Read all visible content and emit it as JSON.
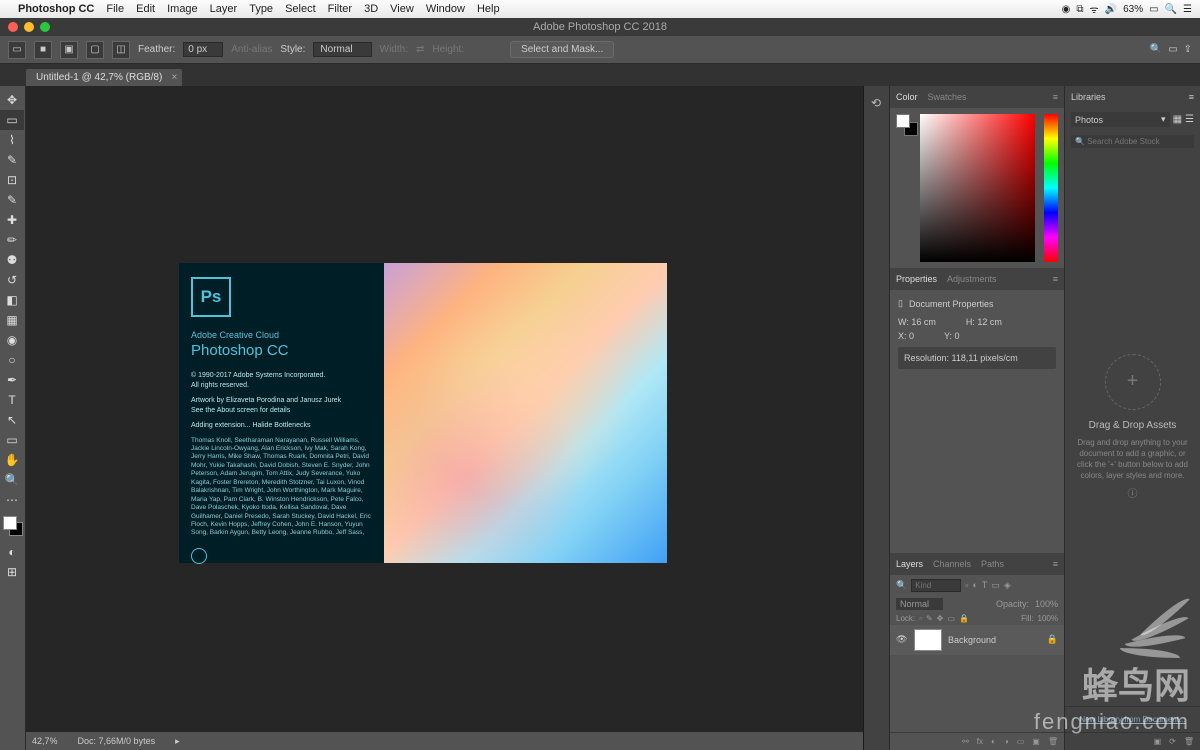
{
  "menubar": {
    "app": "Photoshop CC",
    "items": [
      "File",
      "Edit",
      "Image",
      "Layer",
      "Type",
      "Select",
      "Filter",
      "3D",
      "View",
      "Window",
      "Help"
    ],
    "battery": "63%"
  },
  "titlebar": {
    "title": "Adobe Photoshop CC 2018"
  },
  "optionsbar": {
    "feather_label": "Feather:",
    "feather_value": "0 px",
    "antialias": "Anti-alias",
    "style_label": "Style:",
    "style_value": "Normal",
    "width_label": "Width:",
    "height_label": "Height:",
    "select_mask": "Select and Mask..."
  },
  "doctab": {
    "label": "Untitled-1 @ 42,7% (RGB/8)"
  },
  "splash": {
    "badge": "Ps",
    "acc": "Adobe Creative Cloud",
    "name": "Photoshop CC",
    "copyright": "© 1990-2017 Adobe Systems Incorporated.\nAll rights reserved.",
    "artwork": "Artwork by Elizaveta Porodina and Janusz Jurek\nSee the About screen for details",
    "adding": "Adding extension... Halide Bottlenecks",
    "credits": "Thomas Knoll, Seetharaman Narayanan, Russell Williams, Jackie Lincoln-Owyang, Alan Erickson, Ivy Mak, Sarah Kong, Jerry Harris, Mike Shaw, Thomas Ruark, Domnita Petri, David Mohr, Yukie Takahashi, David Dobish, Steven E. Snyder, John Peterson, Adam Jerugim, Tom Attix, Judy Severance, Yuko Kagita, Foster Brereton, Meredith Stotzner, Tai Luxon, Vinod Balakrishnan, Tim Wright, John Worthington, Mark Maguire, Maria Yap, Pam Clark, B. Winston Hendrickson, Pete Falco, Dave Polaschek, Kyoko Itoda, Kellisa Sandoval, Dave Guilhamer, Daniel Presedo, Sarah Stuckey, David Hackel, Eric Floch, Kevin Hopps, Jeffrey Cohen, John E. Hanson, Yuyun Song, Barkin Aygun, Betty Leong, Jeanne Rubbo, Jeff Sass,"
  },
  "statusbar": {
    "zoom": "42,7%",
    "doc": "Doc: 7,66M/0 bytes"
  },
  "panels": {
    "color": {
      "tab1": "Color",
      "tab2": "Swatches"
    },
    "properties": {
      "tab1": "Properties",
      "tab2": "Adjustments",
      "title": "Document Properties",
      "w": "W: 16 cm",
      "h": "H: 12 cm",
      "x": "X: 0",
      "y": "Y: 0",
      "res": "Resolution: 118,11 pixels/cm"
    },
    "layers": {
      "tab1": "Layers",
      "tab2": "Channels",
      "tab3": "Paths",
      "kind": "Kind",
      "blend": "Normal",
      "opacity_label": "Opacity:",
      "opacity": "100%",
      "lock_label": "Lock:",
      "fill_label": "Fill:",
      "fill": "100%",
      "layer_name": "Background"
    }
  },
  "libraries": {
    "tab": "Libraries",
    "dropdown": "Photos",
    "search_placeholder": "Search Adobe Stock",
    "drop_title": "Drag & Drop Assets",
    "drop_sub": "Drag and drop anything to your document to add a graphic, or click the '+' button below to add colors, layer styles and more.",
    "footer": "New Library from Document..."
  }
}
